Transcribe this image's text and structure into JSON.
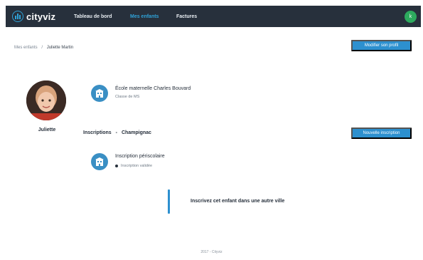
{
  "app": {
    "name": "cityviz"
  },
  "nav": {
    "items": [
      {
        "label": "Tableau de bord",
        "active": false
      },
      {
        "label": "Mes enfants",
        "active": true
      },
      {
        "label": "Factures",
        "active": false
      }
    ],
    "user_initial": "k"
  },
  "breadcrumb": {
    "parent": "Mes enfants",
    "separator": "/",
    "current": "Juliette Martin"
  },
  "actions": {
    "edit_profile": "Modifier son profil",
    "new_inscription": "Nouvelle inscription"
  },
  "child": {
    "name": "Juliette"
  },
  "school": {
    "name": "École maternelle Charles Bouvard",
    "class": "Classe de MS"
  },
  "inscriptions": {
    "heading": "Inscriptions",
    "separator": "-",
    "city": "Champignac",
    "items": [
      {
        "title": "Inscription périscolaire",
        "status": "Inscription validée"
      }
    ]
  },
  "callout": {
    "text": "Inscrivez cet enfant dans une autre ville"
  },
  "footer": {
    "text": "2017 - Cityviz"
  },
  "colors": {
    "navbar": "#27303c",
    "accent": "#2d90cf",
    "active_nav": "#2fa3d9",
    "avatar": "#2daa5e",
    "school_icon": "#3a8fc4"
  },
  "icons": [
    "cityviz-logo-icon",
    "user-avatar",
    "school-building-icon",
    "status-dot-icon"
  ]
}
